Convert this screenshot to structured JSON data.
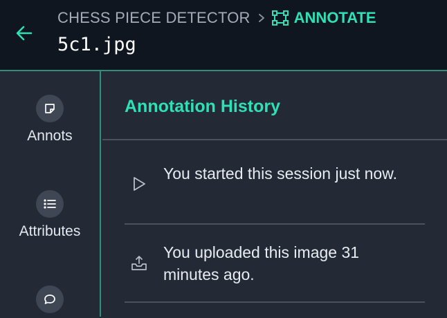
{
  "header": {
    "back_icon": "arrow-left-icon",
    "project_name": "CHESS PIECE DETECTOR",
    "separator_icon": "chevron-right-icon",
    "mode_icon": "bounding-box-icon",
    "mode_label": "ANNOTATE",
    "filename": "5c1.jpg"
  },
  "sidebar": {
    "items": [
      {
        "icon": "sticky-note-icon",
        "label": "Annots"
      },
      {
        "icon": "list-icon",
        "label": "Attributes"
      },
      {
        "icon": "comment-icon",
        "label": ""
      }
    ]
  },
  "panel": {
    "title": "Annotation History",
    "history": [
      {
        "icon": "play-icon",
        "text": "You started this session just now."
      },
      {
        "icon": "upload-icon",
        "text": "You uploaded this image 31 minutes ago."
      }
    ]
  },
  "colors": {
    "accent": "#2fe0b7",
    "header_bg": "#0f1620",
    "panel_bg": "#232a36",
    "border": "#2f8f7c"
  }
}
